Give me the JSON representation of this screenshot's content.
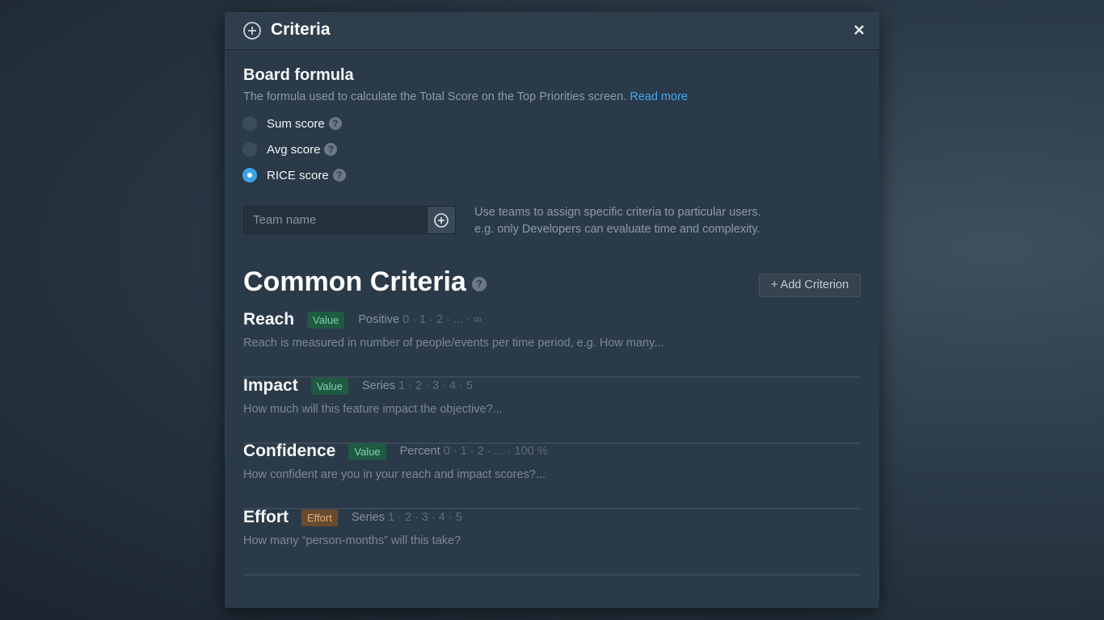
{
  "modal": {
    "title": "Criteria",
    "header_icon": "plus-circle-icon",
    "close_icon": "close-icon"
  },
  "board_formula": {
    "title": "Board formula",
    "description": "The formula used to calculate the Total Score on the Top Priorities screen.",
    "read_more": "Read more",
    "options": [
      {
        "label": "Sum score",
        "checked": false
      },
      {
        "label": "Avg score",
        "checked": false
      },
      {
        "label": "RICE score",
        "checked": true
      }
    ],
    "help_glyph": "?"
  },
  "team": {
    "placeholder": "Team name",
    "help_line1": "Use teams to assign specific criteria to particular users.",
    "help_line2": "e.g. only Developers can evaluate time and complexity."
  },
  "common_criteria": {
    "title": "Common Criteria",
    "add_button": "+ Add Criterion",
    "items": [
      {
        "name": "Reach",
        "badge": "Value",
        "badge_type": "value",
        "scale": "Positive",
        "steps": "0 · 1 · 2 · ... · ∞",
        "description": "Reach is measured in number of people/events per time period, e.g. How many..."
      },
      {
        "name": "Impact",
        "badge": "Value",
        "badge_type": "value",
        "scale": "Series",
        "steps": "1 · 2 · 3 · 4 · 5",
        "description": "How much will this feature impact the objective?..."
      },
      {
        "name": "Confidence",
        "badge": "Value",
        "badge_type": "value",
        "scale": "Percent",
        "steps": "0 · 1 · 2 · ... · 100 %",
        "description": "How confident are you in your reach and impact scores?..."
      },
      {
        "name": "Effort",
        "badge": "Effort",
        "badge_type": "effort",
        "scale": "Series",
        "steps": "1 · 2 · 3 · 4 · 5",
        "description": "How many “person-months” will this take?"
      }
    ]
  },
  "colors": {
    "accent": "#3fa9f5",
    "value_badge": "#1f5a43",
    "effort_badge": "#6a4a2e"
  }
}
